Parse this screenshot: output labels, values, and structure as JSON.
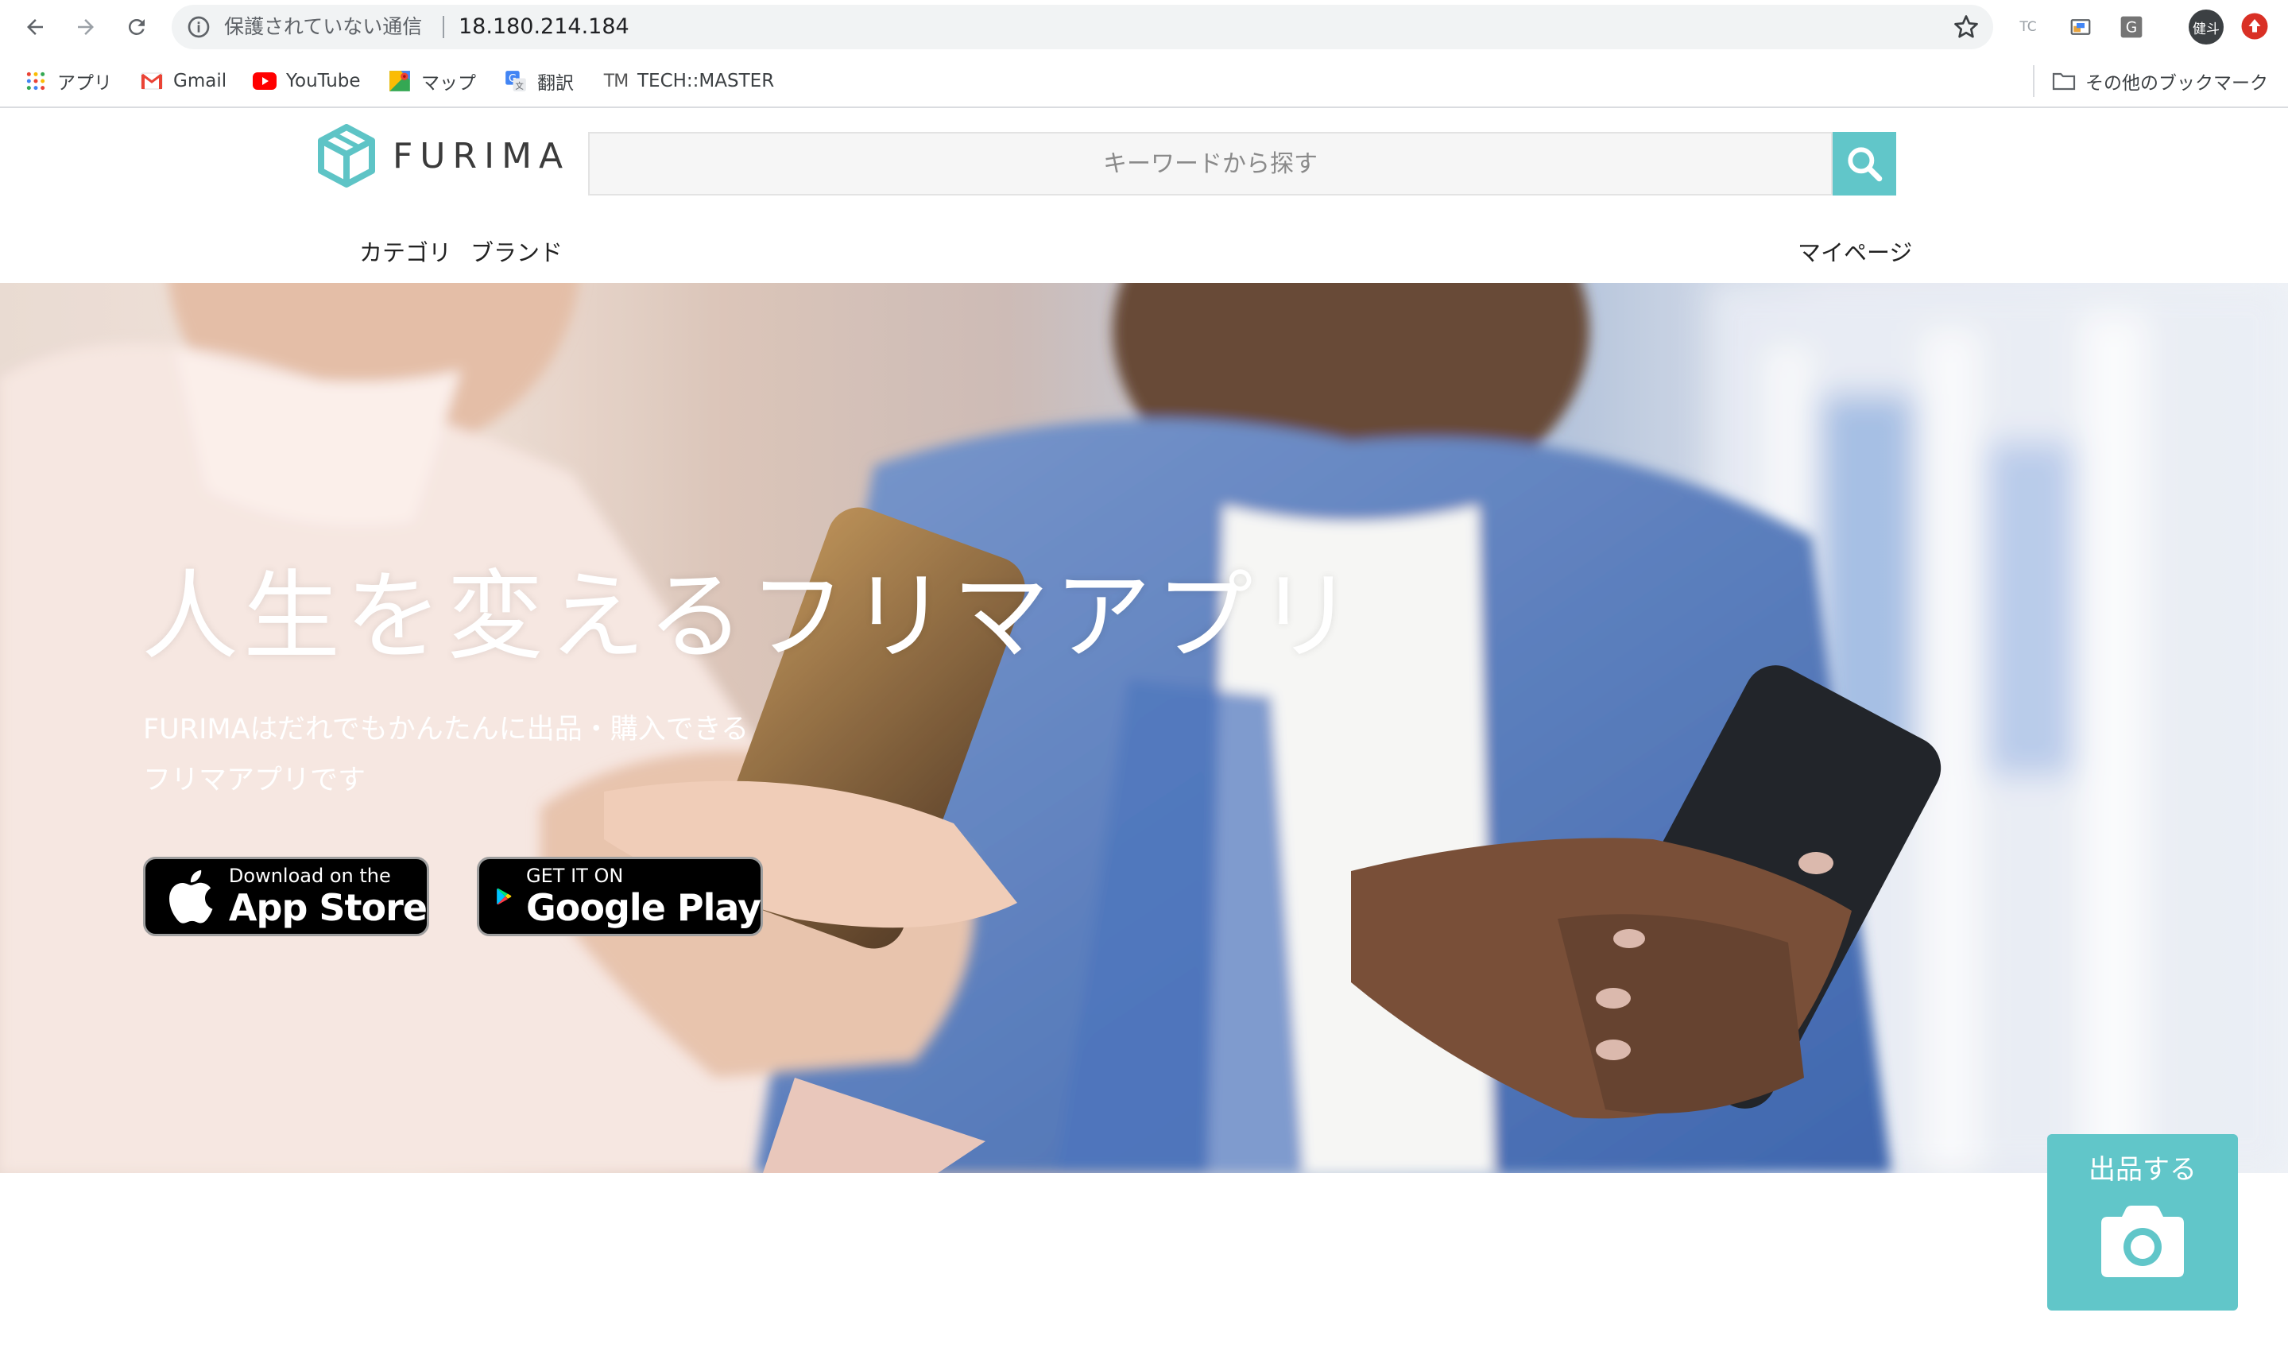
{
  "browser": {
    "security_label": "保護されていない通信",
    "url": "18.180.214.184",
    "profile_initials": "健斗",
    "extensions": [
      "tc-extension-icon",
      "cast-icon",
      "g-extension-icon"
    ]
  },
  "bookmarks": {
    "items": [
      {
        "label": "アプリ",
        "icon": "apps-grid-icon"
      },
      {
        "label": "Gmail",
        "icon": "gmail-icon"
      },
      {
        "label": "YouTube",
        "icon": "youtube-icon"
      },
      {
        "label": "マップ",
        "icon": "maps-icon"
      },
      {
        "label": "翻訳",
        "icon": "translate-icon"
      },
      {
        "label": "TECH::MASTER",
        "icon": "tm-icon"
      }
    ],
    "other_folder": "その他のブックマーク"
  },
  "header": {
    "logo_text": "FURIMA",
    "search_placeholder": "キーワードから探す",
    "category_link": "カテゴリ",
    "brand_link": "ブランド",
    "mypage_link": "マイページ"
  },
  "hero": {
    "title": "人生を変えるフリマアプリ",
    "subtitle_line1": "FURIMAはだれでもかんたんに出品・購入できる",
    "subtitle_line2": "フリマアプリです",
    "app_store": {
      "small": "Download on the",
      "large": "App Store"
    },
    "google_play": {
      "small": "GET IT ON",
      "large": "Google Play"
    }
  },
  "sell_button": {
    "label": "出品する",
    "icon": "camera-icon"
  },
  "colors": {
    "accent": "#61c6c9",
    "logo_cube": "#5ec4c6"
  }
}
